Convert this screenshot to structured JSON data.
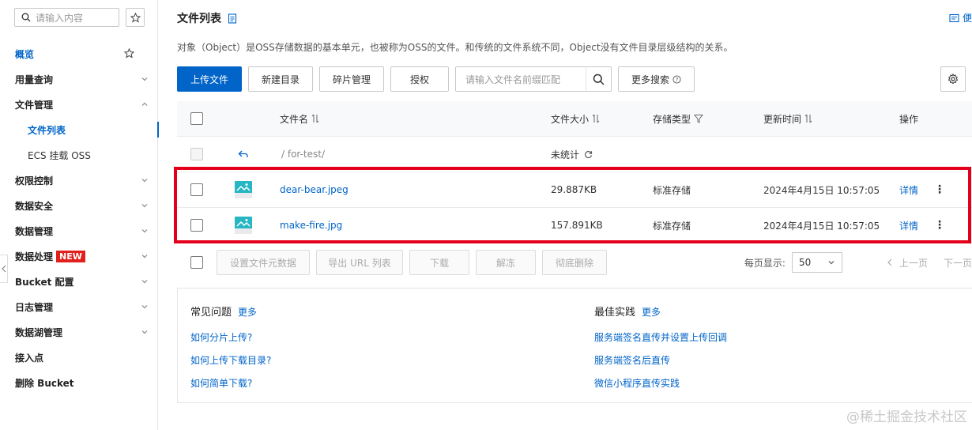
{
  "sidebar": {
    "search_placeholder": "请输入内容",
    "items": [
      {
        "label": "概览"
      },
      {
        "label": "用量查询"
      },
      {
        "label": "文件管理"
      },
      {
        "label": "文件列表"
      },
      {
        "label": "ECS 挂载 OSS"
      },
      {
        "label": "权限控制"
      },
      {
        "label": "数据安全"
      },
      {
        "label": "数据管理"
      },
      {
        "label": "数据处理",
        "badge": "NEW"
      },
      {
        "label": "Bucket 配置"
      },
      {
        "label": "日志管理"
      },
      {
        "label": "数据湖管理"
      },
      {
        "label": "接入点"
      },
      {
        "label": "删除 Bucket"
      }
    ]
  },
  "header": {
    "title": "文件列表",
    "doc_link": "便",
    "description": "对象（Object）是OSS存储数据的基本单元，也被称为OSS的文件。和传统的文件系统不同，Object没有文件目录层级结构的关系。"
  },
  "toolbar": {
    "upload": "上传文件",
    "new_dir": "新建目录",
    "fragments": "碎片管理",
    "authorize": "授权",
    "search_placeholder": "请输入文件名前缀匹配",
    "more_search": "更多搜索"
  },
  "table": {
    "columns": {
      "name": "文件名",
      "size": "文件大小",
      "storage": "存储类型",
      "updated": "更新时间",
      "actions": "操作"
    },
    "parent_row": {
      "path": "/ for-test/",
      "size": "未统计"
    },
    "rows": [
      {
        "name": "dear-bear.jpeg",
        "size": "29.887KB",
        "storage": "标准存储",
        "updated": "2024年4月15日 10:57:05",
        "action": "详情"
      },
      {
        "name": "make-fire.jpg",
        "size": "157.891KB",
        "storage": "标准存储",
        "updated": "2024年4月15日 10:57:05",
        "action": "详情"
      }
    ]
  },
  "batch": {
    "set_meta": "设置文件元数据",
    "export_url": "导出 URL 列表",
    "download": "下载",
    "unfreeze": "解冻",
    "delete": "彻底删除"
  },
  "pager": {
    "per_page_label": "每页显示:",
    "per_page": "50",
    "prev": "上一页",
    "next": "下一页"
  },
  "faq": {
    "left_title": "常见问题",
    "left_more": "更多",
    "left_links": [
      "如何分片上传?",
      "如何上传下载目录?",
      "如何简单下载?"
    ],
    "right_title": "最佳实践",
    "right_more": "更多",
    "right_links": [
      "服务端签名直传并设置上传回调",
      "服务端签名后直传",
      "微信小程序直传实践"
    ]
  },
  "watermark": "@稀土掘金技术社区",
  "colors": {
    "accent": "#0064c8",
    "highlight": "#e4001b",
    "badge": "#e0201c"
  }
}
